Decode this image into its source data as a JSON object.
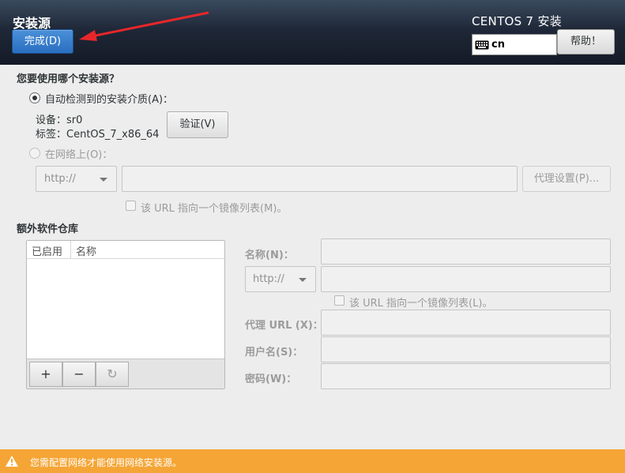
{
  "header": {
    "title": "安装源",
    "done_label": "完成(D)",
    "product_title": "CENTOS 7 安装",
    "keyboard_layout": "cn",
    "help_label": "帮助！"
  },
  "source": {
    "question": "您要使用哪个安装源？",
    "auto_detect_label": "自动检测到的安装介质(A)：",
    "device_line": "设备：sr0",
    "label_line": "标签：CentOS_7_x86_64",
    "verify_label": "验证(V)",
    "network_label": "在网络上(O)：",
    "protocol_value": "http://",
    "url_value": "",
    "proxy_label": "代理设置(P)...",
    "mirrorlist_label": "该 URL 指向一个镜像列表(M)。"
  },
  "repos": {
    "heading": "额外软件仓库",
    "columns": [
      "已启用",
      "名称"
    ],
    "add_label": "+",
    "remove_label": "−",
    "refresh_label": "↻"
  },
  "repo_form": {
    "name_label": "名称(N)：",
    "protocol_value": "http://",
    "mirrorlist_label": "该 URL 指向一个镜像列表(L)。",
    "proxy_url_label": "代理 URL (X)：",
    "username_label": "用户名(S)：",
    "password_label": "密码(W)："
  },
  "warning": {
    "text": "您需配置网络才能使用网络安装源。",
    "color": "#f5a535"
  },
  "colors": {
    "accent": "#2a6fc0",
    "header_bg": "#1f2838",
    "annotation_arrow": "#e8262a"
  }
}
